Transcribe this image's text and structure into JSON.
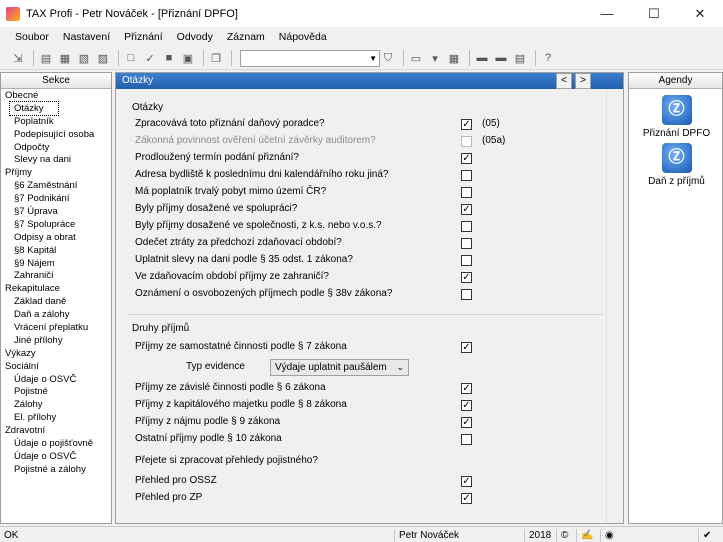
{
  "window": {
    "title": "TAX Profi - Petr Nováček - [Přiznání DPFO]",
    "minimize": "—",
    "maximize": "☐",
    "close": "✕"
  },
  "menu": [
    {
      "label": "Soubor"
    },
    {
      "label": "Nastavení"
    },
    {
      "label": "Přiznání"
    },
    {
      "label": "Odvody"
    },
    {
      "label": "Záznam"
    },
    {
      "label": "Nápověda"
    }
  ],
  "sidebar": {
    "title": "Sekce",
    "items": [
      {
        "label": "Obecné",
        "level": 0
      },
      {
        "label": "Otázky",
        "level": 1,
        "selected": true
      },
      {
        "label": "Poplatník",
        "level": 1
      },
      {
        "label": "Podepisující osoba",
        "level": 1
      },
      {
        "label": "Odpočty",
        "level": 1
      },
      {
        "label": "Slevy na dani",
        "level": 1
      },
      {
        "label": "Příjmy",
        "level": 0
      },
      {
        "label": "§6 Zaměstnání",
        "level": 1
      },
      {
        "label": "§7 Podnikání",
        "level": 1
      },
      {
        "label": "§7 Úprava",
        "level": 1
      },
      {
        "label": "§7 Spolupráce",
        "level": 1
      },
      {
        "label": "Odpisy a obrat",
        "level": 1
      },
      {
        "label": "§8 Kapitál",
        "level": 1
      },
      {
        "label": "§9 Nájem",
        "level": 1
      },
      {
        "label": "Zahraničí",
        "level": 1
      },
      {
        "label": "Rekapitulace",
        "level": 0
      },
      {
        "label": "Základ daně",
        "level": 1
      },
      {
        "label": "Daň a zálohy",
        "level": 1
      },
      {
        "label": "Vrácení přeplatku",
        "level": 1
      },
      {
        "label": "Jiné přílohy",
        "level": 1
      },
      {
        "label": "Výkazy",
        "level": 0
      },
      {
        "label": "Sociální",
        "level": 0
      },
      {
        "label": "Údaje o OSVČ",
        "level": 1
      },
      {
        "label": "Pojistné",
        "level": 1
      },
      {
        "label": "Zálohy",
        "level": 1
      },
      {
        "label": "El. přílohy",
        "level": 1
      },
      {
        "label": "Zdravotní",
        "level": 0
      },
      {
        "label": "Údaje o pojišťovně",
        "level": 1
      },
      {
        "label": "Údaje o OSVČ",
        "level": 1
      },
      {
        "label": "Pojistné a zálohy",
        "level": 1
      }
    ]
  },
  "main": {
    "header": "Otázky",
    "prev": "<",
    "next": ">",
    "group1_title": "Otázky",
    "questions": [
      {
        "label": "Zpracovává toto přiznání daňový poradce?",
        "checked": true,
        "code": "(05)"
      },
      {
        "label": "Zákonná povinnost ověření účetní závěrky auditorem?",
        "checked": false,
        "code": "(05a)",
        "disabled": true
      },
      {
        "label": "Prodloužený termín podání přiznání?",
        "checked": true
      },
      {
        "label": "Adresa bydliště k poslednímu dni kalendářního roku jiná?",
        "checked": false
      },
      {
        "label": "Má poplatník trvalý pobyt mimo území ČR?",
        "checked": false
      },
      {
        "label": "Byly příjmy dosažené ve spolupráci?",
        "checked": true
      },
      {
        "label": "Byly příjmy dosažené ve společnosti, z k.s. nebo v.o.s.?",
        "checked": false
      },
      {
        "label": "Odečet ztráty za předchozí zdaňovací období?",
        "checked": false
      },
      {
        "label": "Uplatnit slevy na dani podle § 35 odst. 1 zákona?",
        "checked": false
      },
      {
        "label": "Ve zdaňovacím období příjmy ze zahraničí?",
        "checked": true
      },
      {
        "label": "Oznámení o osvobozených příjmech podle § 38v zákona?",
        "checked": false
      }
    ],
    "group2_title": "Druhy příjmů",
    "income": [
      {
        "label": "Příjmy ze samostatné činnosti podle § 7 zákona",
        "checked": true
      },
      {
        "label": "Příjmy ze závislé činnosti podle § 6 zákona",
        "checked": true
      },
      {
        "label": "Příjmy z kapitálového majetku podle § 8 zákona",
        "checked": true
      },
      {
        "label": "Příjmy z nájmu podle § 9 zákona",
        "checked": true
      },
      {
        "label": "Ostatní příjmy podle § 10 zákona",
        "checked": false
      }
    ],
    "evidence_label": "Typ evidence",
    "evidence_value": "Výdaje uplatnit paušálem",
    "insurance_question": "Přejete si zpracovat přehledy pojistného?",
    "insurance": [
      {
        "label": "Přehled pro OSSZ",
        "checked": true
      },
      {
        "label": "Přehled pro ZP",
        "checked": true
      }
    ]
  },
  "agendy": {
    "title": "Agendy",
    "items": [
      {
        "label": "Přiznání DPFO",
        "icon": "tax-return-icon"
      },
      {
        "label": "Daň z příjmů",
        "icon": "income-tax-icon"
      }
    ]
  },
  "status": {
    "state": "OK",
    "user": "Petr Nováček",
    "year": "2018"
  }
}
